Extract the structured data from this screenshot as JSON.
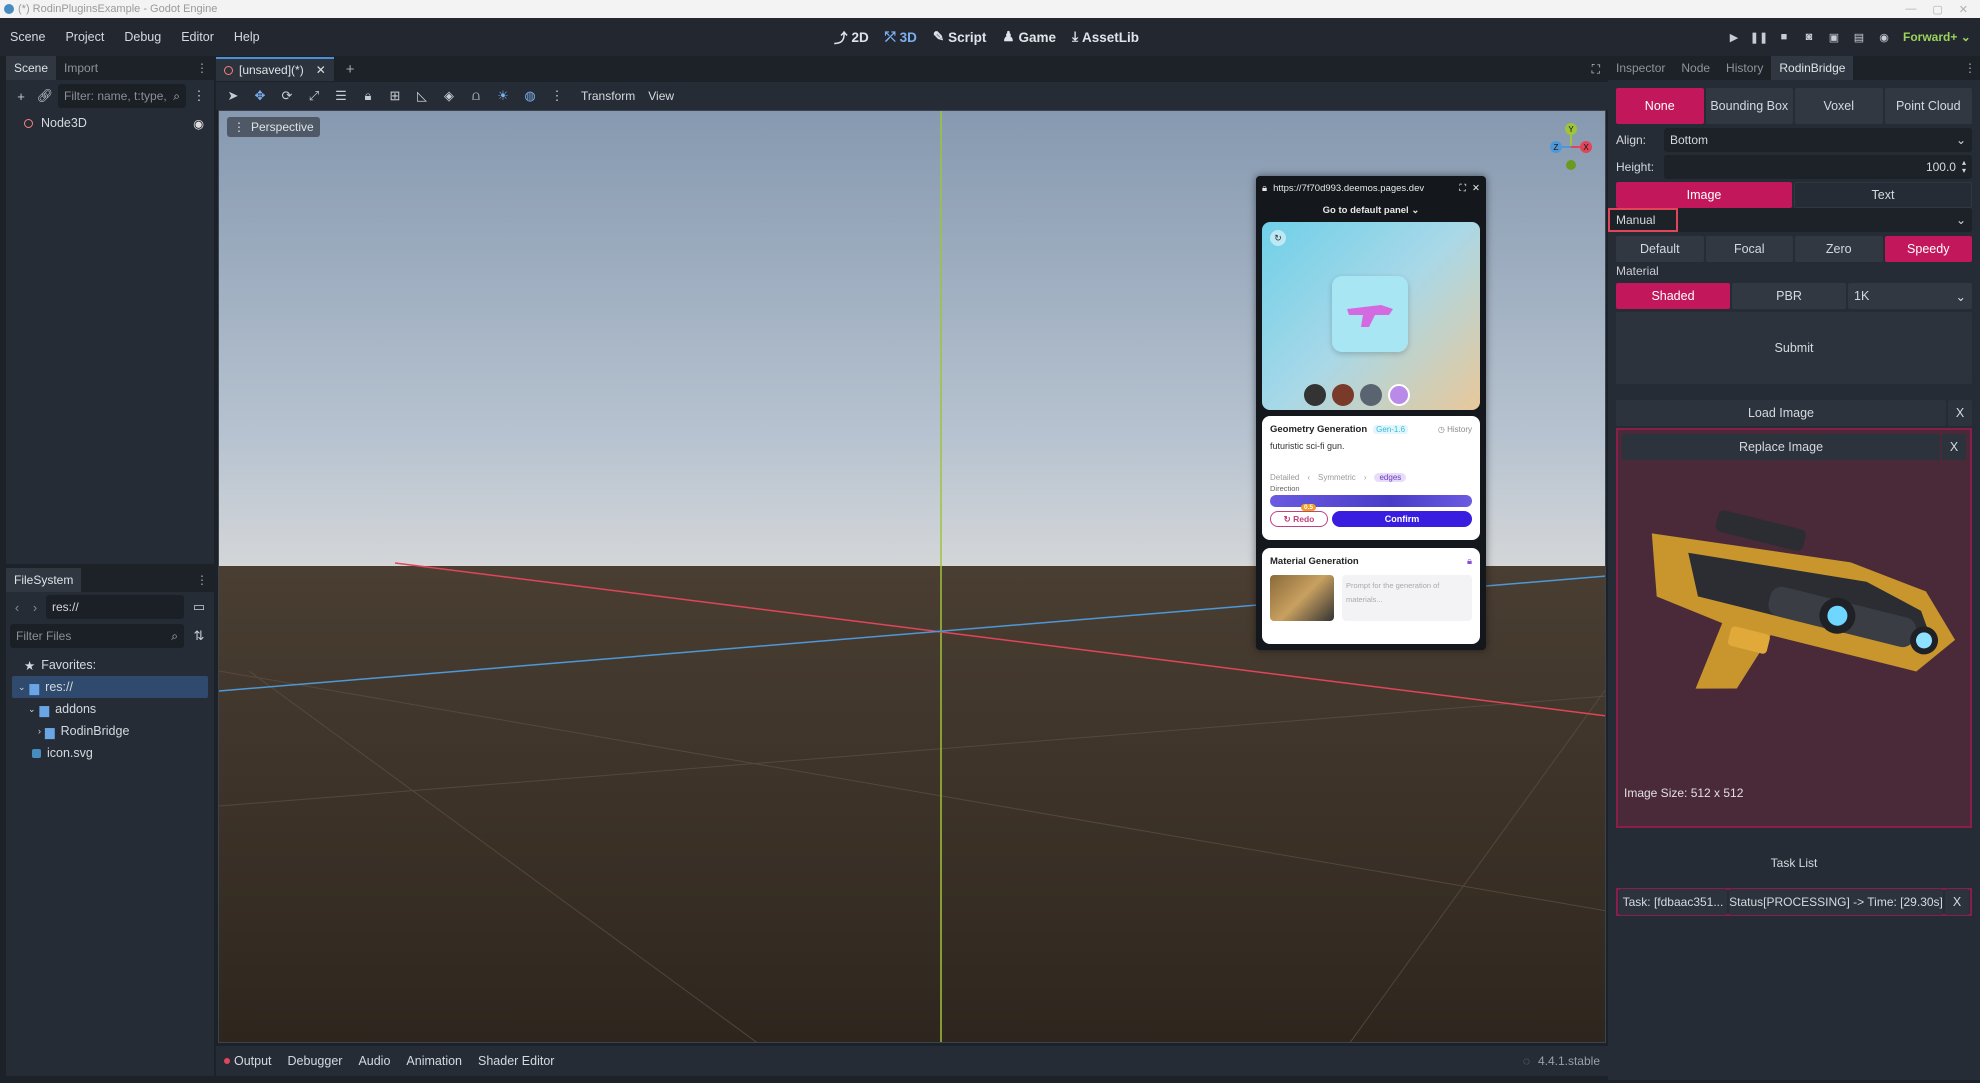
{
  "window": {
    "title": "(*) RodinPluginsExample - Godot Engine",
    "controls": [
      "—",
      "▢",
      "✕"
    ]
  },
  "menubar": {
    "items": [
      "Scene",
      "Project",
      "Debug",
      "Editor",
      "Help"
    ],
    "workspaces": [
      "2D",
      "3D",
      "Script",
      "Game",
      "AssetLib"
    ],
    "active_workspace": "3D",
    "renderer": "Forward+"
  },
  "scene_dock": {
    "tabs": [
      "Scene",
      "Import"
    ],
    "filter_placeholder": "Filter: name, t:type,",
    "nodes": [
      {
        "name": "Node3D"
      }
    ]
  },
  "filesystem_dock": {
    "title": "FileSystem",
    "path": "res://",
    "filter_placeholder": "Filter Files",
    "tree": [
      {
        "label": "Favorites:"
      },
      {
        "label": "res://"
      },
      {
        "label": "addons"
      },
      {
        "label": "RodinBridge"
      },
      {
        "label": "icon.svg"
      }
    ]
  },
  "viewport": {
    "tab_label": "[unsaved](*)",
    "toolbar_menus": [
      "Transform",
      "View"
    ],
    "perspective_label": "Perspective",
    "gizmo": {
      "y": "Y",
      "x": "X",
      "z": "Z"
    },
    "axis_colors": {
      "x": "#e0455a",
      "y": "#9ec43a",
      "z": "#4e98d8"
    }
  },
  "bottom_panel": {
    "tabs": [
      "Output",
      "Debugger",
      "Audio",
      "Animation",
      "Shader Editor"
    ],
    "version": "4.4.1.stable"
  },
  "overlay": {
    "url": "https://7f70d993.deemos.pages.dev",
    "panel_selector": "Go to default panel",
    "geometry": {
      "title": "Geometry Generation",
      "badge": "Gen-1.6",
      "history": "History",
      "prompt": "futuristic sci-fi gun.",
      "options": [
        "Detailed",
        "Symmetric",
        "edges"
      ],
      "direction_label": "Direction",
      "redo_label": "Redo",
      "confirm_label": "Confirm",
      "cost_badge": "0.5"
    },
    "material": {
      "title": "Material Generation",
      "prompt_placeholder": "Prompt for the generation of materials..."
    }
  },
  "inspector": {
    "tabs": [
      "Inspector",
      "Node",
      "History",
      "RodinBridge"
    ],
    "active_tab": "RodinBridge",
    "mesh_modes": [
      "None",
      "Bounding Box",
      "Voxel",
      "Point Cloud"
    ],
    "active_mesh_mode": "None",
    "align_label": "Align:",
    "align_value": "Bottom",
    "height_label": "Height:",
    "height_value": "100.0",
    "input_modes": [
      "Image",
      "Text"
    ],
    "active_input_mode": "Image",
    "pose_value": "Manual",
    "quality_modes": [
      "Default",
      "Focal",
      "Zero",
      "Speedy"
    ],
    "active_quality_mode": "Speedy",
    "material_label": "Material",
    "material_modes": [
      "Shaded",
      "PBR"
    ],
    "active_material_mode": "Shaded",
    "resolution": "1K",
    "submit_label": "Submit",
    "load_image_label": "Load Image",
    "replace_image_label": "Replace Image",
    "close_label": "X",
    "image_size": "Image Size: 512 x 512",
    "task_list_label": "Task List",
    "task": {
      "id": "Task: [fdbaac351...",
      "status": "Status[PROCESSING] -> Time: [29.30s]"
    }
  },
  "colors": {
    "accent": "#c2185b",
    "editor_bg": "#262c35",
    "sky_top": "#8ea3bc",
    "ground": "#3a3026"
  }
}
